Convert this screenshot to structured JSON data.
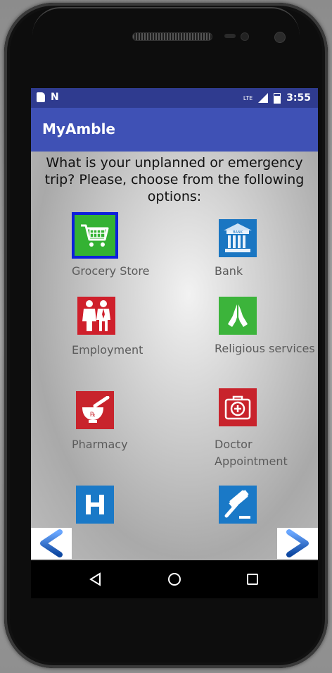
{
  "status_bar": {
    "network_label": "LTE",
    "time": "3:55"
  },
  "app": {
    "title": "MyAmble"
  },
  "question": {
    "text": "What is your unplanned or emergency trip? Please, choose from the following options:"
  },
  "options": [
    {
      "label": "Grocery Store",
      "icon": "shopping-cart-icon",
      "selected": true,
      "color": "#34b233"
    },
    {
      "label": "Bank",
      "icon": "bank-icon",
      "selected": false,
      "color": "#1a76c2"
    },
    {
      "label": "Employment",
      "icon": "employees-icon",
      "selected": false,
      "color": "#cf1f2b"
    },
    {
      "label": "Religious services",
      "icon": "praying-hands-icon",
      "selected": false,
      "color": "#3cb43b"
    },
    {
      "label": "Pharmacy",
      "icon": "mortar-pestle-icon",
      "selected": false,
      "color": "#c8232c"
    },
    {
      "label": "Doctor Appointment",
      "icon": "medical-kit-icon",
      "selected": false,
      "color": "#c8232c"
    },
    {
      "label": "",
      "icon": "hospital-icon",
      "selected": false,
      "color": "#1a79c7"
    },
    {
      "label": "",
      "icon": "gavel-icon",
      "selected": false,
      "color": "#1a79c7"
    }
  ],
  "colors": {
    "app_bar": "#3f51b5",
    "status_bar": "#2f3b8f",
    "selection_border": "#0d1fdc",
    "arrow": "#1565c0"
  }
}
